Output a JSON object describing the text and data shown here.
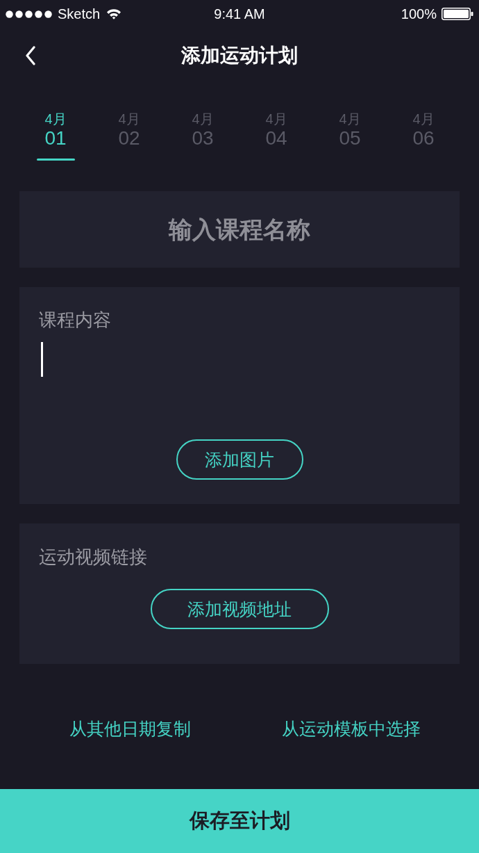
{
  "status_bar": {
    "carrier": "Sketch",
    "time": "9:41 AM",
    "battery": "100%"
  },
  "nav": {
    "title": "添加运动计划"
  },
  "dates": [
    {
      "month": "4月",
      "day": "01",
      "selected": true
    },
    {
      "month": "4月",
      "day": "02",
      "selected": false
    },
    {
      "month": "4月",
      "day": "03",
      "selected": false
    },
    {
      "month": "4月",
      "day": "04",
      "selected": false
    },
    {
      "month": "4月",
      "day": "05",
      "selected": false
    },
    {
      "month": "4月",
      "day": "06",
      "selected": false
    }
  ],
  "course_name": {
    "placeholder": "输入课程名称"
  },
  "course_content": {
    "label": "课程内容",
    "button": "添加图片"
  },
  "video_link": {
    "label": "运动视频链接",
    "button": "添加视频地址"
  },
  "links": [
    "从其他日期复制",
    "从运动模板中选择"
  ],
  "save_button": "保存至计划"
}
